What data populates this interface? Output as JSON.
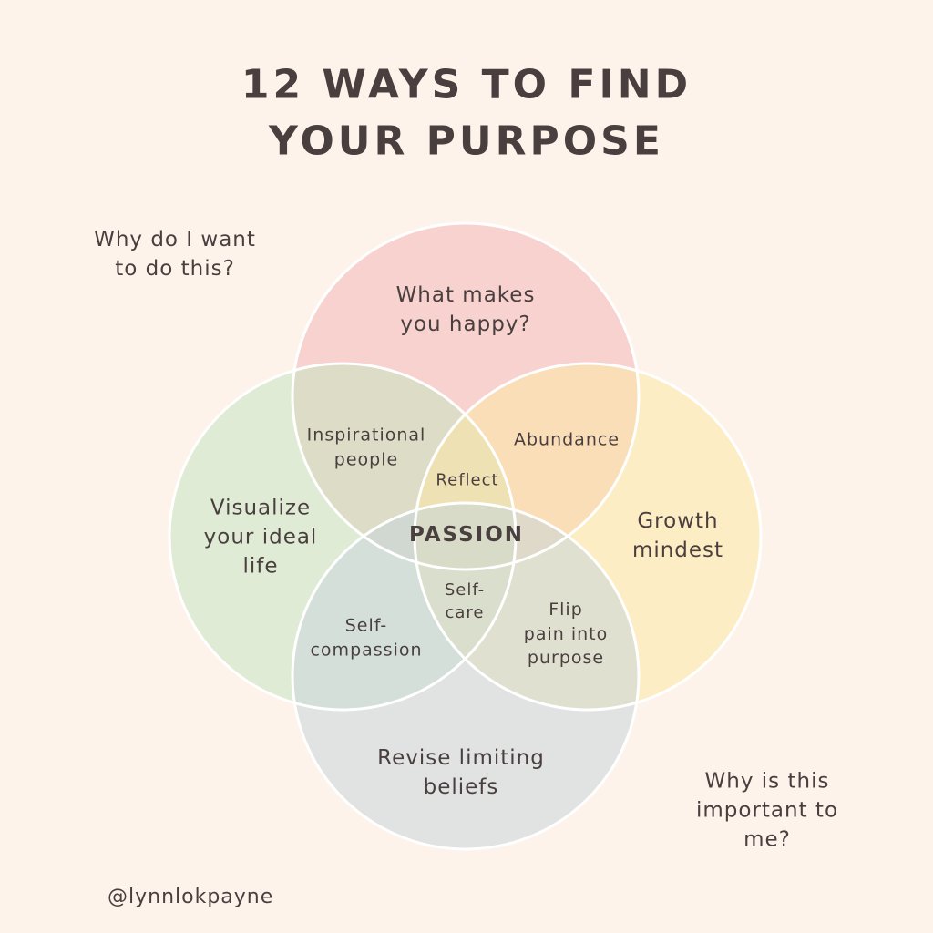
{
  "title": "12 WAYS TO FIND YOUR PURPOSE",
  "question_top_left": "Why do I want\nto do this?",
  "question_bottom_right": "Why is this\nimportant to me?",
  "handle": "@lynnlokpayne",
  "colors": {
    "background": "#fdf3ea",
    "top_circle": "#f2b6b8",
    "left_circle": "#c7e3c1",
    "right_circle": "#fde8a4",
    "bottom_circle": "#c9d5db",
    "outline": "#ffffff",
    "text": "#4a3f3f"
  },
  "circles": {
    "top": "What makes\nyou happy?",
    "left": "Visualize\nyour ideal\nlife",
    "right": "Growth\nmindest",
    "bottom": "Revise limiting\nbeliefs"
  },
  "overlaps": {
    "top_left": "Inspirational\npeople",
    "top_right": "Abundance",
    "bottom_left": "Self-\ncompassion",
    "bottom_right": "Flip\npain into\npurpose",
    "upper_center": "Reflect",
    "lower_center": "Self-\ncare",
    "center": "PASSION"
  }
}
